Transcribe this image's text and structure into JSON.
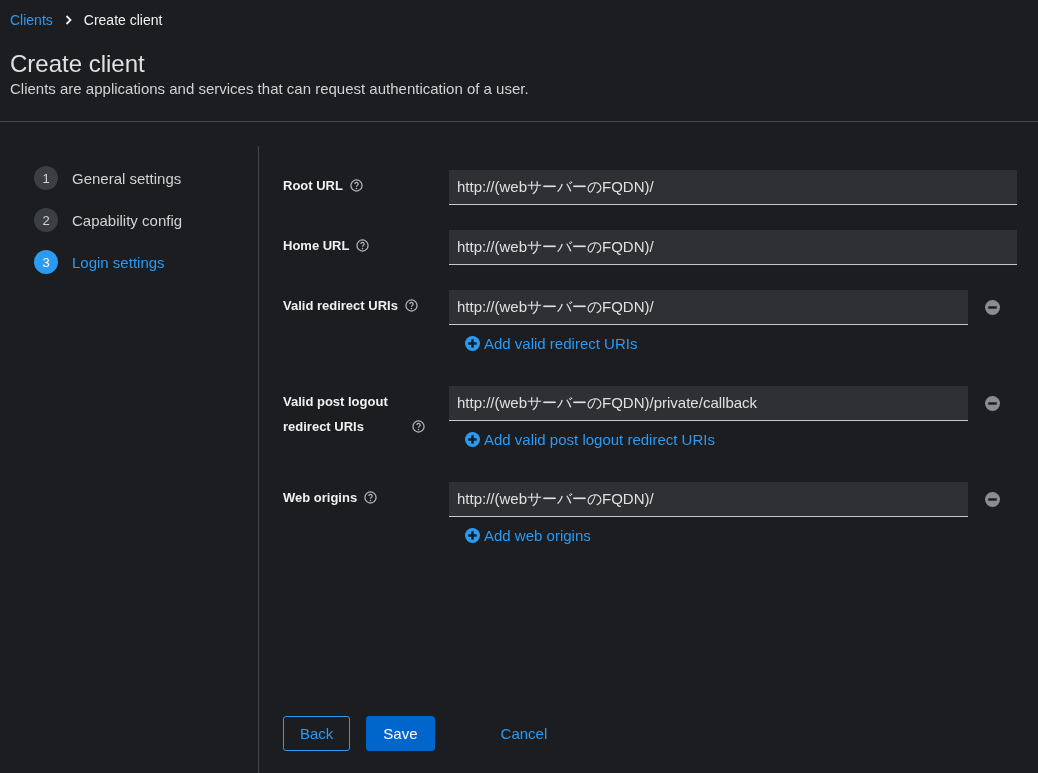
{
  "breadcrumb": [
    {
      "label": "Clients",
      "kind": "link"
    },
    {
      "label": "Create client",
      "kind": "current"
    }
  ],
  "header": {
    "title": "Create client",
    "description": "Clients are applications and services that can request authentication of a user."
  },
  "steps": [
    {
      "number": "1",
      "label": "General settings",
      "selected": false
    },
    {
      "number": "2",
      "label": "Capability config",
      "selected": false
    },
    {
      "number": "3",
      "label": "Login settings",
      "selected": true
    }
  ],
  "fields": [
    {
      "kind": "single",
      "label": "Root URL",
      "value": "http://(webサーバーのFQDN)/"
    },
    {
      "kind": "single",
      "label": "Home URL",
      "value": "http://(webサーバーのFQDN)/"
    },
    {
      "kind": "multi",
      "label": "Valid redirect URIs",
      "value": "http://(webサーバーのFQDN)/",
      "add_label": "Add valid redirect URIs"
    },
    {
      "kind": "multi",
      "label": "Valid post logout redirect URIs",
      "value": "http://(webサーバーのFQDN)/private/callback",
      "add_label": "Add valid post logout redirect URIs"
    },
    {
      "kind": "multi",
      "label": "Web origins",
      "value": "http://(webサーバーのFQDN)/",
      "add_label": "Add web origins"
    }
  ],
  "buttons": [
    {
      "label": "Back",
      "kind": "secondary"
    },
    {
      "label": "Save",
      "kind": "primary"
    },
    {
      "label": "Cancel",
      "kind": "link"
    }
  ]
}
